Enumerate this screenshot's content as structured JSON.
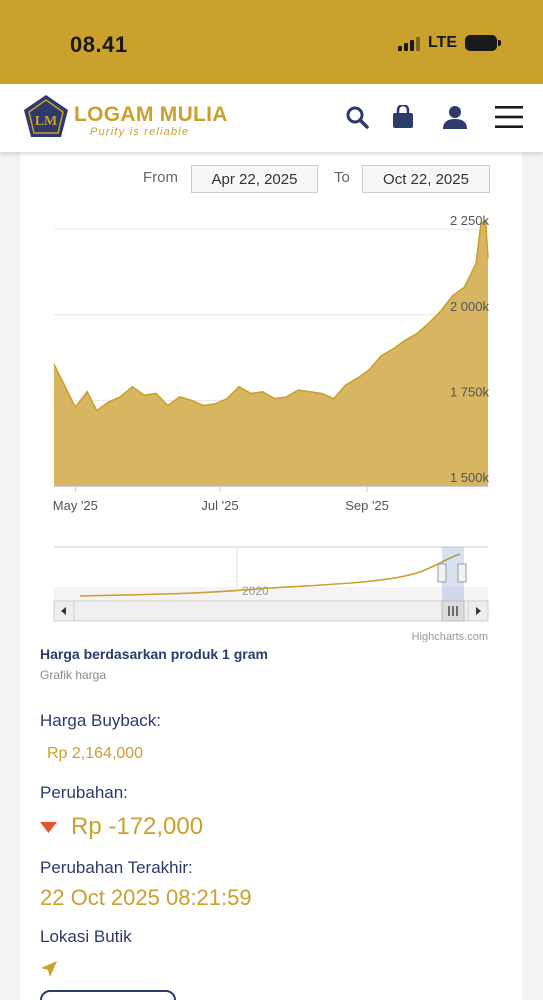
{
  "status_bar": {
    "time": "08.41",
    "network": "LTE"
  },
  "header": {
    "brand_name": "LOGAM MULIA",
    "tagline": "Purity is reliable",
    "logo_initials": "LM",
    "icons": [
      "search-icon",
      "shopping-bag-icon",
      "user-icon",
      "menu-icon"
    ],
    "brand_color": "#c9a12c",
    "navy_color": "#2d3a6b"
  },
  "range": {
    "from_label": "From",
    "from_value": "Apr 22, 2025",
    "to_label": "To",
    "to_value": "Oct 22, 2025"
  },
  "chart_data": {
    "type": "area",
    "title": "",
    "x": [
      "2025-04-22",
      "2025-04-26",
      "2025-05-01",
      "2025-05-06",
      "2025-05-10",
      "2025-05-15",
      "2025-05-20",
      "2025-05-25",
      "2025-05-30",
      "2025-06-04",
      "2025-06-09",
      "2025-06-14",
      "2025-06-19",
      "2025-06-24",
      "2025-06-29",
      "2025-07-04",
      "2025-07-09",
      "2025-07-14",
      "2025-07-19",
      "2025-07-24",
      "2025-07-29",
      "2025-08-03",
      "2025-08-08",
      "2025-08-13",
      "2025-08-18",
      "2025-08-23",
      "2025-08-28",
      "2025-09-02",
      "2025-09-07",
      "2025-09-12",
      "2025-09-17",
      "2025-09-22",
      "2025-09-27",
      "2025-10-02",
      "2025-10-07",
      "2025-10-12",
      "2025-10-17",
      "2025-10-19",
      "2025-10-21",
      "2025-10-22"
    ],
    "values": [
      1855,
      1800,
      1730,
      1775,
      1720,
      1745,
      1760,
      1790,
      1765,
      1770,
      1735,
      1760,
      1750,
      1735,
      1740,
      1755,
      1790,
      1770,
      1775,
      1755,
      1760,
      1780,
      1775,
      1770,
      1755,
      1795,
      1815,
      1840,
      1880,
      1900,
      1925,
      1945,
      1975,
      2010,
      2055,
      2080,
      2150,
      2265,
      2275,
      2164
    ],
    "ylim": [
      1500,
      2300
    ],
    "y_ticks": [
      "1 500k",
      "1 750k",
      "2 000k",
      "2 250k"
    ],
    "x_ticks": [
      "May '25",
      "Jul '25",
      "Sep '25"
    ],
    "navigator_label": "2020",
    "credit": "Highcharts.com",
    "series_color": "#c9a12c",
    "fill_color": "#d8b561",
    "grid": true
  },
  "caption": {
    "title": "Harga berdasarkan produk 1 gram",
    "subtitle": "Grafik harga"
  },
  "info": {
    "buyback_label": "Harga Buyback:",
    "buyback_value": "Rp 2,164,000",
    "change_label": "Perubahan:",
    "change_value": "Rp -172,000",
    "change_direction": "down",
    "change_color": "#e5532e",
    "last_change_label": "Perubahan Terakhir:",
    "last_change_value": "22 Oct 2025 08:21:59",
    "location_label": "Lokasi Butik",
    "location_icon": "location-arrow-icon"
  }
}
